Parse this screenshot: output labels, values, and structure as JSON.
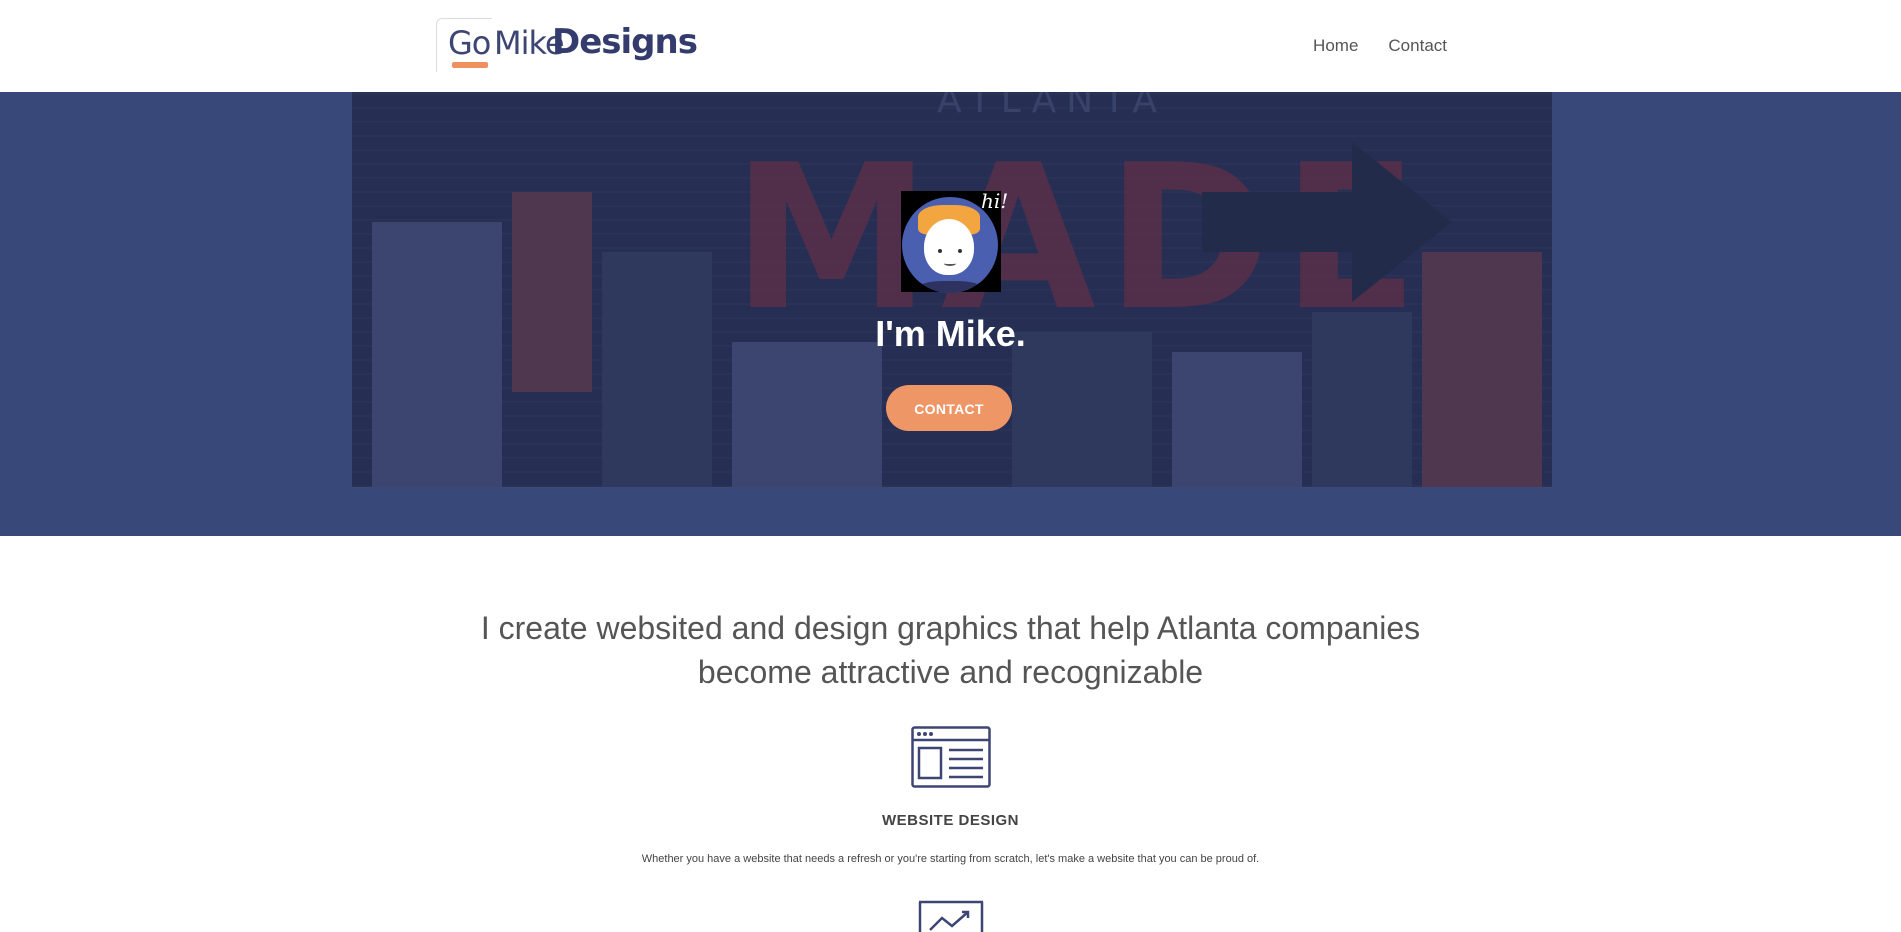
{
  "header": {
    "logo": {
      "go": "Go",
      "mike": "Mike",
      "designs": "Designs"
    },
    "nav": [
      {
        "label": "Home"
      },
      {
        "label": "Contact"
      }
    ]
  },
  "hero": {
    "avatar_hi": "hi!",
    "title": "I'm Mike.",
    "contact_label": "CONTACT",
    "photo_sign_text": "ATLANTA",
    "photo_made_text": "MADE"
  },
  "intro": {
    "tagline_line1": "I create websited and design graphics that help Atlanta companies",
    "tagline_line2": "become attractive and recognizable"
  },
  "services": [
    {
      "icon": "browser-window-icon",
      "title": "WEBSITE DESIGN",
      "description": "Whether you have a website that needs a refresh or you're starting from scratch, let's make a website that you can be proud of."
    },
    {
      "icon": "growth-chart-icon"
    }
  ],
  "colors": {
    "brand_navy": "#384878",
    "accent_orange": "#ef9667",
    "text_gray": "#555555"
  }
}
